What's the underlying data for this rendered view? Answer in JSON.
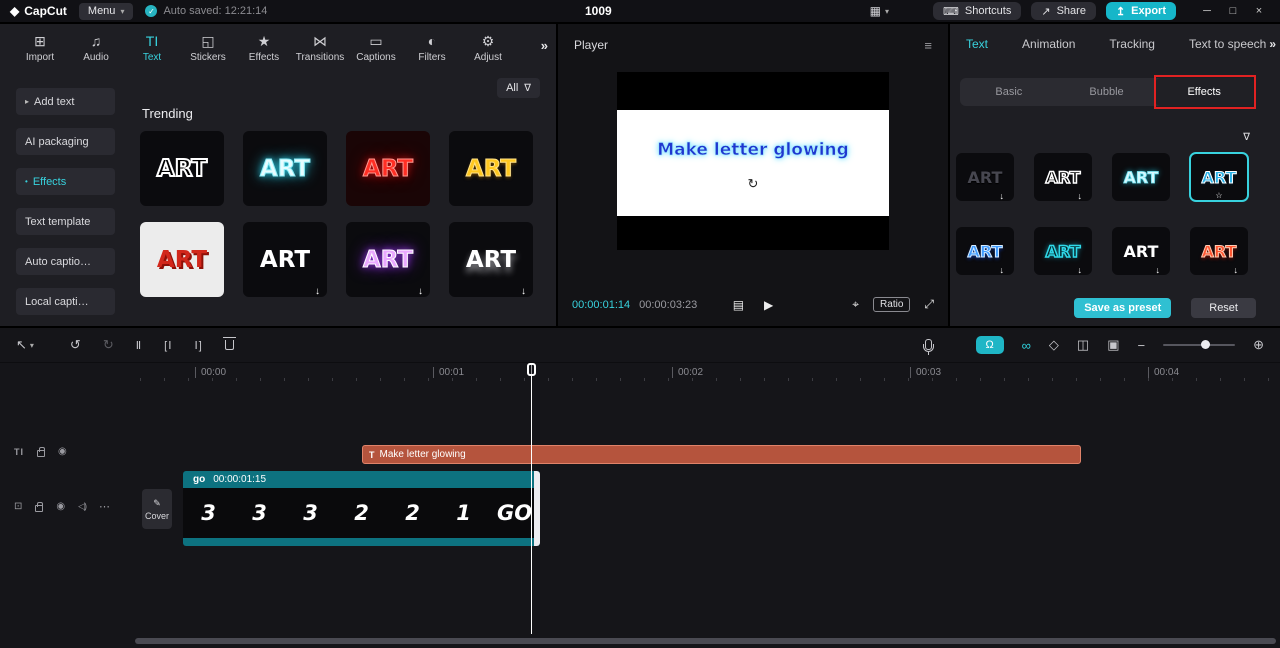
{
  "titlebar": {
    "app_name": "CapCut",
    "menu_label": "Menu",
    "autosave_text": "Auto saved: 12:21:14",
    "doc_title": "1009",
    "shortcuts_label": "Shortcuts",
    "share_label": "Share",
    "export_label": "Export"
  },
  "media_toolbar": {
    "items": [
      {
        "label": "Import",
        "icon": "⊞"
      },
      {
        "label": "Audio",
        "icon": "♫"
      },
      {
        "label": "Text",
        "icon": "TI",
        "active": true
      },
      {
        "label": "Stickers",
        "icon": "◱"
      },
      {
        "label": "Effects",
        "icon": "★"
      },
      {
        "label": "Transitions",
        "icon": "⋈"
      },
      {
        "label": "Captions",
        "icon": "▭"
      },
      {
        "label": "Filters",
        "icon": "◐"
      },
      {
        "label": "Adjust",
        "icon": "⚙"
      }
    ]
  },
  "sidebar": {
    "items": [
      {
        "label": "Add text"
      },
      {
        "label": "AI packaging"
      },
      {
        "label": "Effects",
        "active": true
      },
      {
        "label": "Text template"
      },
      {
        "label": "Auto captio…"
      },
      {
        "label": "Local capti…"
      }
    ]
  },
  "library": {
    "section_title": "Trending",
    "filter_label": "All",
    "tiles": [
      {
        "label": "ART",
        "style": "outline-white"
      },
      {
        "label": "ART",
        "style": "neon-cyan"
      },
      {
        "label": "ART",
        "style": "neon-red"
      },
      {
        "label": "ART",
        "style": "gold"
      },
      {
        "label": "ART",
        "style": "red-on-white"
      },
      {
        "label": "ART",
        "style": "bold-white",
        "dl": "↓"
      },
      {
        "label": "ART",
        "style": "purple-glow",
        "dl": "↓"
      },
      {
        "label": "ART",
        "style": "white-shadow",
        "dl": "↓"
      }
    ]
  },
  "player": {
    "title": "Player",
    "preview_text": "Make letter glowing",
    "current_time": "00:00:01:14",
    "total_time": "00:00:03:23",
    "ratio_label": "Ratio"
  },
  "inspector": {
    "tabs": [
      {
        "label": "Text",
        "active": true
      },
      {
        "label": "Animation"
      },
      {
        "label": "Tracking"
      },
      {
        "label": "Text to speech"
      }
    ],
    "subtabs": [
      {
        "label": "Basic"
      },
      {
        "label": "Bubble"
      },
      {
        "label": "Effects",
        "active": true,
        "annotated": true
      }
    ],
    "tiles": [
      {
        "label": "ART",
        "style": "gray-emboss",
        "dl": "↓"
      },
      {
        "label": "ART",
        "style": "outline-white-sm",
        "dl": "↓"
      },
      {
        "label": "ART",
        "style": "cyan-glow-sm"
      },
      {
        "label": "ART",
        "style": "blue-sticker",
        "selected": true
      },
      {
        "label": "ART",
        "style": "blue-grad",
        "dl": "↓"
      },
      {
        "label": "ART",
        "style": "cyan-outline",
        "dl": "↓"
      },
      {
        "label": "ART",
        "style": "bold-white-sm",
        "dl": "↓"
      },
      {
        "label": "ART",
        "style": "red-grad",
        "dl": "↓"
      }
    ],
    "save_preset_label": "Save as preset",
    "reset_label": "Reset"
  },
  "timeline": {
    "ruler_labels": [
      "00:00",
      "00:01",
      "00:02",
      "00:03",
      "00:04"
    ],
    "text_clip": {
      "label": "Make letter glowing"
    },
    "video_clip": {
      "name": "go",
      "duration": "00:00:01:15",
      "frames": [
        "3",
        "3",
        "3",
        "2",
        "2",
        "1",
        "GO"
      ]
    },
    "cover_label": "Cover"
  },
  "colors": {
    "accent": "#38d2de",
    "annotation_red": "#e12222",
    "text_clip_fill": "#b5543d",
    "video_clip_bar": "#0d7280"
  },
  "icons": {
    "logo": "◆",
    "caret": "▾",
    "check": "✓",
    "grid": "▦",
    "keyboard": "⌨",
    "share": "↗",
    "export": "↥",
    "minimize": "─",
    "maximize": "□",
    "close": "×",
    "more": "»",
    "filter": "∇",
    "hamburger": "≡",
    "list": "▤",
    "play": "▶",
    "focus": "⌖",
    "expand": "⤢",
    "rotate": "↻",
    "select": "↖",
    "undo": "↺",
    "redo": "↻",
    "split": "Ⅱ",
    "trim_left": "[Ⅰ",
    "trim_right": "Ⅰ]",
    "magnet": "Ω",
    "link": "∞",
    "keyframe": "◇",
    "mirror": "◫",
    "snapshot": "▣",
    "zoom_out": "−",
    "zoom_in": "⊕",
    "text_track": "TI",
    "media": "⊡",
    "eye": "◉",
    "speaker": "◁)",
    "dots": "⋯",
    "pencil": "✎",
    "star": "☆",
    "expand_arrow": "▸",
    "bullet": "•",
    "text_clip": "T"
  }
}
